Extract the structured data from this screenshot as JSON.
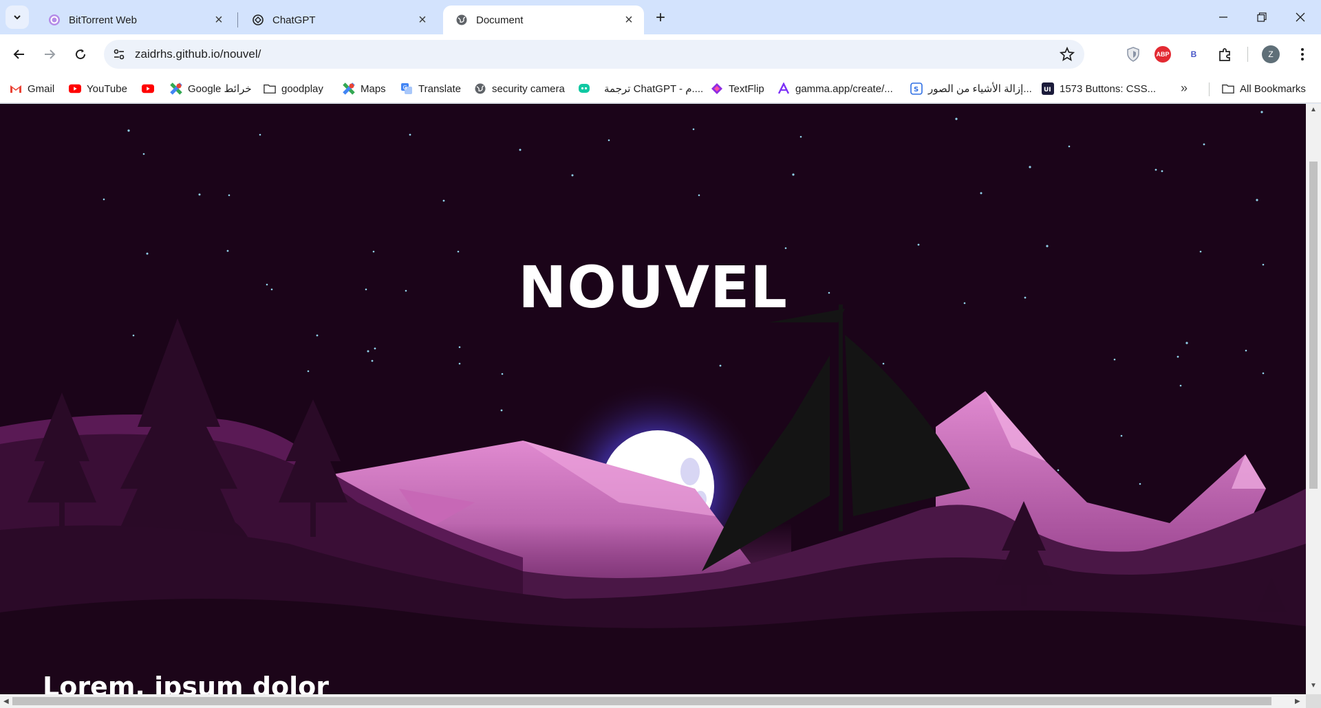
{
  "browser": {
    "tabs": [
      {
        "title": "BitTorrent Web",
        "icon": "bittorrent-icon",
        "active": false
      },
      {
        "title": "ChatGPT",
        "icon": "chatgpt-icon",
        "active": false
      },
      {
        "title": "Document",
        "icon": "globe-icon",
        "active": true
      }
    ],
    "url": "zaidrhs.github.io/nouvel/",
    "extensions": [
      "shield-extension-icon",
      "adblock-plus-icon",
      "b-extension-icon",
      "extensions-puzzle-icon"
    ],
    "abp_label": "ABP",
    "b_label": "B",
    "profile_initial": "Z"
  },
  "bookmarks": [
    {
      "label": "Gmail",
      "icon": "gmail-icon"
    },
    {
      "label": "YouTube",
      "icon": "youtube-icon"
    },
    {
      "label": "",
      "icon": "youtube-icon"
    },
    {
      "label": "Google خرائط",
      "icon": "google-maps-icon"
    },
    {
      "label": "goodplay",
      "icon": "folder-icon"
    },
    {
      "label": "Maps",
      "icon": "google-maps-icon"
    },
    {
      "label": "Translate",
      "icon": "google-translate-icon"
    },
    {
      "label": "security camera",
      "icon": "globe-icon"
    },
    {
      "label": "ترجمة ChatGPT - م....",
      "icon": "chat-bubble-icon"
    },
    {
      "label": "TextFlip",
      "icon": "textflip-icon"
    },
    {
      "label": "gamma.app/create/...",
      "icon": "gamma-icon"
    },
    {
      "label": "إزالة الأشياء من الصور...",
      "icon": "remove-objects-icon"
    },
    {
      "label": "1573 Buttons: CSS...",
      "icon": "uiverse-icon"
    }
  ],
  "all_bookmarks_label": "All Bookmarks",
  "page": {
    "title": "NOUVEL",
    "subtitle": "Lorem, ipsum dolor"
  },
  "colors": {
    "sky": "#1a0418",
    "mountain_pink": "#d77ac2",
    "mountain_mid": "#8a3a7e",
    "hills_dark": "#3a0f33",
    "moon": "#ffffff",
    "moon_glow": "#6a5cff",
    "sail": "#141414"
  }
}
